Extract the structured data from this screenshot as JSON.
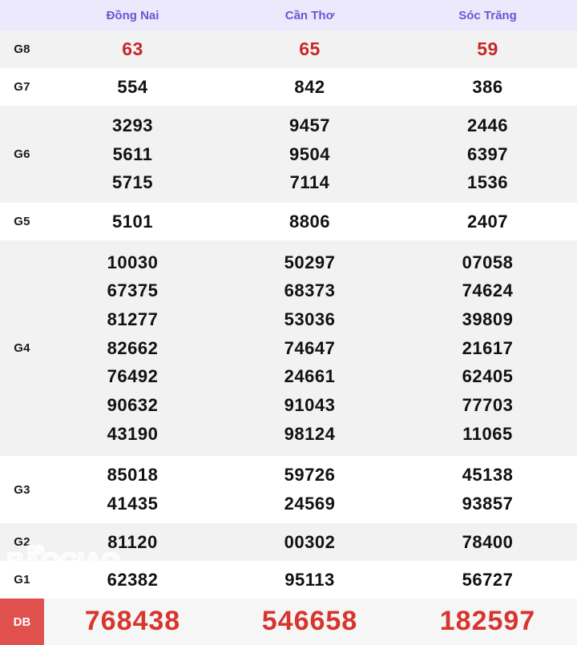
{
  "table": {
    "header": {
      "label_blank": "",
      "provinces": [
        "Đồng Nai",
        "Cần Thơ",
        "Sóc Trăng"
      ]
    },
    "rows": [
      {
        "group": "G8",
        "values": [
          [
            "63"
          ],
          [
            "65"
          ],
          [
            "59"
          ]
        ],
        "style": "red-small",
        "shade": "shade"
      },
      {
        "group": "G7",
        "values": [
          [
            "554"
          ],
          [
            "842"
          ],
          [
            "386"
          ]
        ],
        "style": "normal",
        "shade": "white"
      },
      {
        "group": "G6",
        "values": [
          [
            "3293",
            "5611",
            "5715"
          ],
          [
            "9457",
            "9504",
            "7114"
          ],
          [
            "2446",
            "6397",
            "1536"
          ]
        ],
        "style": "normal",
        "shade": "shade"
      },
      {
        "group": "G5",
        "values": [
          [
            "5101"
          ],
          [
            "8806"
          ],
          [
            "2407"
          ]
        ],
        "style": "normal",
        "shade": "white"
      },
      {
        "group": "G4",
        "values": [
          [
            "10030",
            "67375",
            "81277",
            "82662",
            "76492",
            "90632",
            "43190"
          ],
          [
            "50297",
            "68373",
            "53036",
            "74647",
            "24661",
            "91043",
            "98124"
          ],
          [
            "07058",
            "74624",
            "39809",
            "21617",
            "62405",
            "77703",
            "11065"
          ]
        ],
        "style": "normal",
        "shade": "shade"
      },
      {
        "group": "G3",
        "values": [
          [
            "85018",
            "41435"
          ],
          [
            "59726",
            "24569"
          ],
          [
            "45138",
            "93857"
          ]
        ],
        "style": "normal",
        "shade": "white"
      },
      {
        "group": "G2",
        "values": [
          [
            "81120"
          ],
          [
            "00302"
          ],
          [
            "78400"
          ]
        ],
        "style": "normal",
        "shade": "shade"
      },
      {
        "group": "G1",
        "values": [
          [
            "62382"
          ],
          [
            "95113"
          ],
          [
            "56727"
          ]
        ],
        "style": "normal",
        "shade": "white"
      },
      {
        "group": "DB",
        "values": [
          [
            "768438"
          ],
          [
            "546658"
          ],
          [
            "182597"
          ]
        ],
        "style": "special",
        "shade": "special"
      }
    ]
  },
  "watermark": {
    "line1": "DB",
    "line2": "BAOGIAO"
  },
  "colors": {
    "header_bg": "#ebe9fb",
    "header_text": "#6558d3",
    "row_shade": "#f2f2f2",
    "row_white": "#ffffff",
    "number_text": "#111111",
    "g8_red": "#c62828",
    "db_red": "#d7352e",
    "db_label_bg": "#e0514e",
    "border": "#e4e4e4"
  }
}
